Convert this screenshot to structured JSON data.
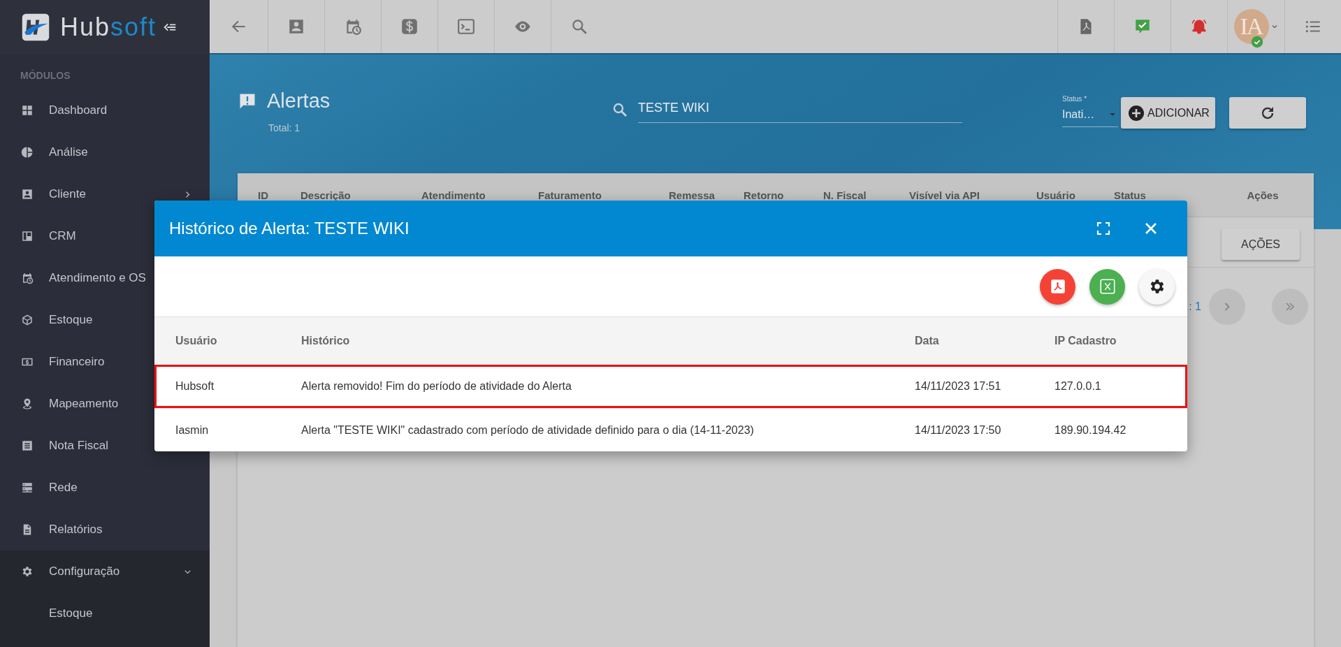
{
  "sidebar": {
    "logo": {
      "main": "Hub",
      "accent": "soft"
    },
    "section_label": "MÓDULOS",
    "items": [
      {
        "kind": "link",
        "label": "Dashboard"
      },
      {
        "kind": "link",
        "label": "Análise"
      },
      {
        "kind": "group",
        "label": "Cliente",
        "expanded": false
      },
      {
        "kind": "link",
        "label": "CRM"
      },
      {
        "kind": "link",
        "label": "Atendimento e OS"
      },
      {
        "kind": "link",
        "label": "Estoque"
      },
      {
        "kind": "link",
        "label": "Financeiro"
      },
      {
        "kind": "link",
        "label": "Mapeamento"
      },
      {
        "kind": "link",
        "label": "Nota Fiscal"
      },
      {
        "kind": "link",
        "label": "Rede"
      },
      {
        "kind": "link",
        "label": "Relatórios"
      },
      {
        "kind": "group",
        "label": "Configuração",
        "expanded": true,
        "children": [
          {
            "label": "Estoque"
          }
        ]
      }
    ]
  },
  "topbar": {
    "avatar": {
      "initials": "IA",
      "online": true
    }
  },
  "header": {
    "title": "Alertas",
    "total": "Total: 1",
    "search": {
      "value": "TESTE WIKI"
    },
    "status_field": {
      "label": "Status *",
      "value": "Inati…"
    },
    "add_button": "ADICIONAR"
  },
  "table": {
    "columns": [
      "ID",
      "Descrição",
      "Atendimento",
      "Faturamento",
      "Remessa",
      "Retorno",
      "N. Fiscal",
      "Visível via API",
      "Usuário",
      "Status",
      "Ações"
    ],
    "row_action": "AÇÕES",
    "pagination": ": 1"
  },
  "modal": {
    "title": "Histórico de Alerta: TESTE WIKI",
    "columns": [
      "Usuário",
      "Histórico",
      "Data",
      "IP Cadastro"
    ],
    "rows": [
      {
        "highlighted": true,
        "cells": [
          "Hubsoft",
          "Alerta removido! Fim do período de atividade do Alerta",
          "14/11/2023 17:51",
          "127.0.0.1"
        ]
      },
      {
        "highlighted": false,
        "cells": [
          "Iasmin",
          "Alerta \"TESTE WIKI\" cadastrado com período de atividade definido para o dia (14-11-2023)",
          "14/11/2023 17:50",
          "189.90.194.42"
        ]
      }
    ]
  }
}
